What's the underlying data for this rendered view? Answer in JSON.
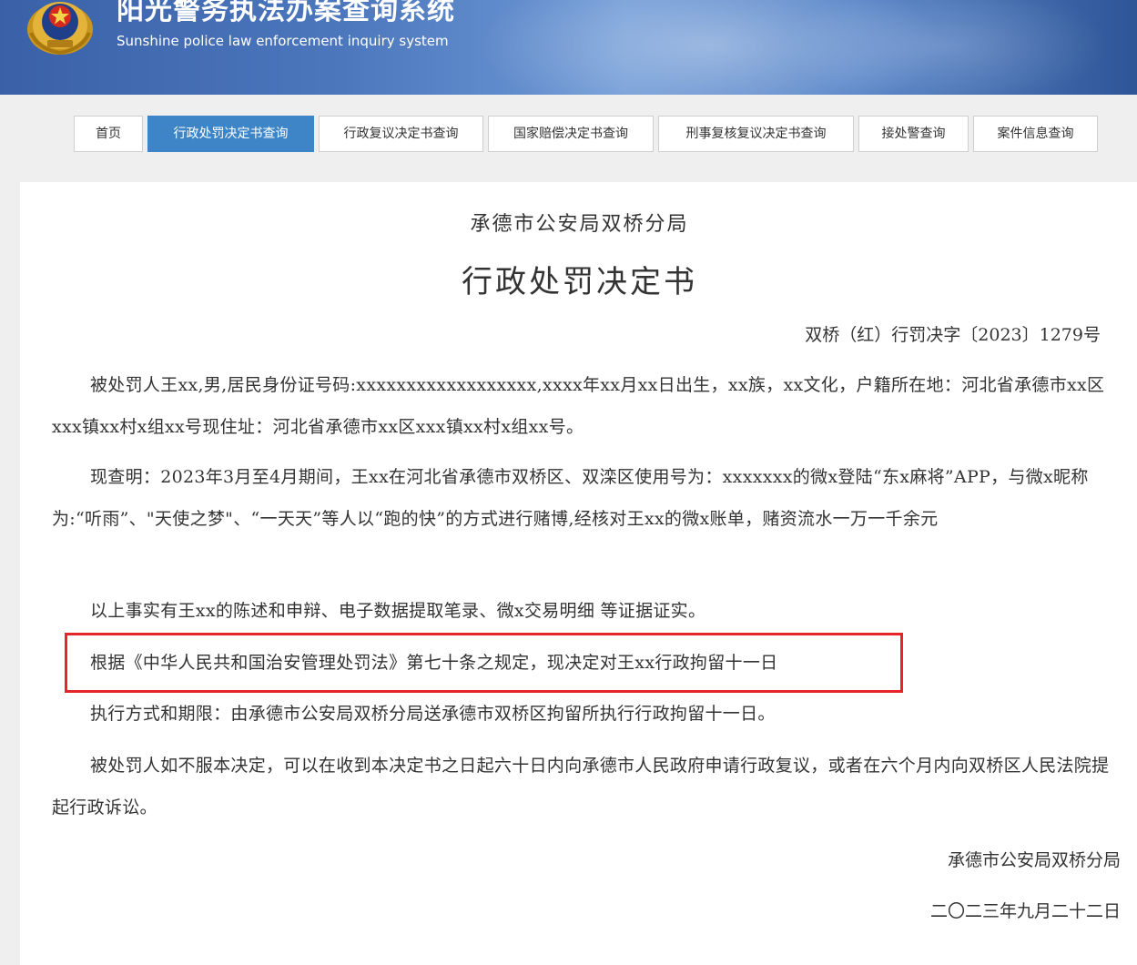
{
  "header": {
    "title_cn": "阳光警务执法办案查询系统",
    "title_en": "Sunshine police law enforcement inquiry system",
    "emblem_icon": "police-emblem-icon"
  },
  "nav": {
    "tabs": [
      {
        "label": "首页",
        "active": false
      },
      {
        "label": "行政处罚决定书查询",
        "active": true
      },
      {
        "label": "行政复议决定书查询",
        "active": false
      },
      {
        "label": "国家赔偿决定书查询",
        "active": false
      },
      {
        "label": "刑事复核复议决定书查询",
        "active": false
      },
      {
        "label": "接处警查询",
        "active": false
      },
      {
        "label": "案件信息查询",
        "active": false
      }
    ]
  },
  "document": {
    "org": "承德市公安局双桥分局",
    "title": "行政处罚决定书",
    "number": "双桥（红）行罚决字〔2023〕1279号",
    "paragraphs": [
      "被处罚人王xx,男,居民身份证号码:xxxxxxxxxxxxxxxxxx,xxxx年xx月xx日出生，xx族，xx文化，户籍所在地：河北省承德市xx区xxx镇xx村x组xx号现住址：河北省承德市xx区xxx镇xx村x组xx号。",
      "现查明：2023年3月至4月期间，王xx在河北省承德市双桥区、双滦区使用号为：xxxxxxx的微x登陆“东x麻将”APP，与微x昵称为:“听雨”、\"天使之梦\"、“一天天”等人以“跑的快”的方式进行赌博,经核对王xx的微x账单，赌资流水一万一千余元",
      "以上事实有王xx的陈述和申辩、电子数据提取笔录、微x交易明细 等证据证实。",
      "根据《中华人民共和国治安管理处罚法》第七十条之规定，现决定对王xx行政拘留十一日",
      "执行方式和期限：由承德市公安局双桥分局送承德市双桥区拘留所执行行政拘留十一日。",
      "被处罚人如不服本决定，可以在收到本决定书之日起六十日内向承德市人民政府申请行政复议，或者在六个月内向双桥区人民法院提起行政诉讼。"
    ],
    "signature_org": "承德市公安局双桥分局",
    "signature_date": "二〇二三年九月二十二日"
  },
  "colors": {
    "active_tab": "#3d85c6",
    "highlight_border": "#e5242b",
    "banner": "#4c77bd"
  }
}
